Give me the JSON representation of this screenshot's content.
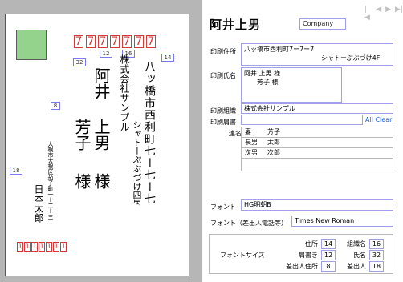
{
  "recipient": {
    "zip": [
      "7",
      "7",
      "7",
      "7",
      "7",
      "7",
      "7"
    ],
    "name_vertical_family": "阿井",
    "name_vertical_line1": "上男",
    "name_vertical_line2": "芳子",
    "honorific": "様",
    "address_line1_vertical": "八ッ橋市西利町七ー七ー七",
    "address_line2_vertical": "シャトーぷぶづけ四F",
    "company_vertical": "株式会社サンプル"
  },
  "sender": {
    "zip": [
      "1",
      "1",
      "1",
      "1",
      "1",
      "1",
      "1"
    ],
    "address_vertical": "大根市大根区茄子町一ー二ー三",
    "name_vertical": "日本太郎"
  },
  "size_tags": {
    "zip_gap": "12",
    "company": "16",
    "address": "14",
    "title_size": "32",
    "name_gap": "8",
    "sender_side": "18"
  },
  "nav": {
    "first": "|◀",
    "prev": "◀",
    "next": "▶",
    "last": "▶|"
  },
  "header": {
    "title": "阿井上男",
    "company_button": "Company"
  },
  "form": {
    "print_address_label": "印刷住所",
    "print_address_line1": "八ッ橋市西利町7ー7ー7",
    "print_address_line2": "シャトーぷぶづけ4F",
    "print_name_label": "印刷氏名",
    "print_name_line1": "阿井 上男 様",
    "print_name_line2": "芳子 様",
    "print_org_label": "印刷組織",
    "print_org_value": "株式会社サンプル",
    "print_title_label": "印刷肩書",
    "print_title_value": "",
    "all_clear_button": "All Clear",
    "joint_label": "連名",
    "joint_names": [
      {
        "relation": "妻",
        "name": "芳子"
      },
      {
        "relation": "長男",
        "name": "太郎"
      },
      {
        "relation": "次男",
        "name": "次郎"
      },
      {
        "relation": "",
        "name": ""
      }
    ],
    "font_label": "フォント",
    "font_value": "HG明朝B",
    "font_sender_label": "フォント（差出人電話等）",
    "font_sender_value": "Times New Roman",
    "font_size_label": "フォントサイズ",
    "sizes": {
      "address_label": "住所",
      "address_value": "14",
      "org_label": "組織名",
      "org_value": "16",
      "title_label": "肩書き",
      "title_value": "12",
      "name_label": "氏名",
      "name_value": "32",
      "sender_address_label": "差出人住所",
      "sender_address_value": "8",
      "sender_label": "差出人",
      "sender_value": "18"
    }
  },
  "colors": {
    "stamp": "#93d38b",
    "zip_red": "#d43a3a",
    "field_border": "#a0a0e8",
    "tag_border": "#7a7af0"
  }
}
